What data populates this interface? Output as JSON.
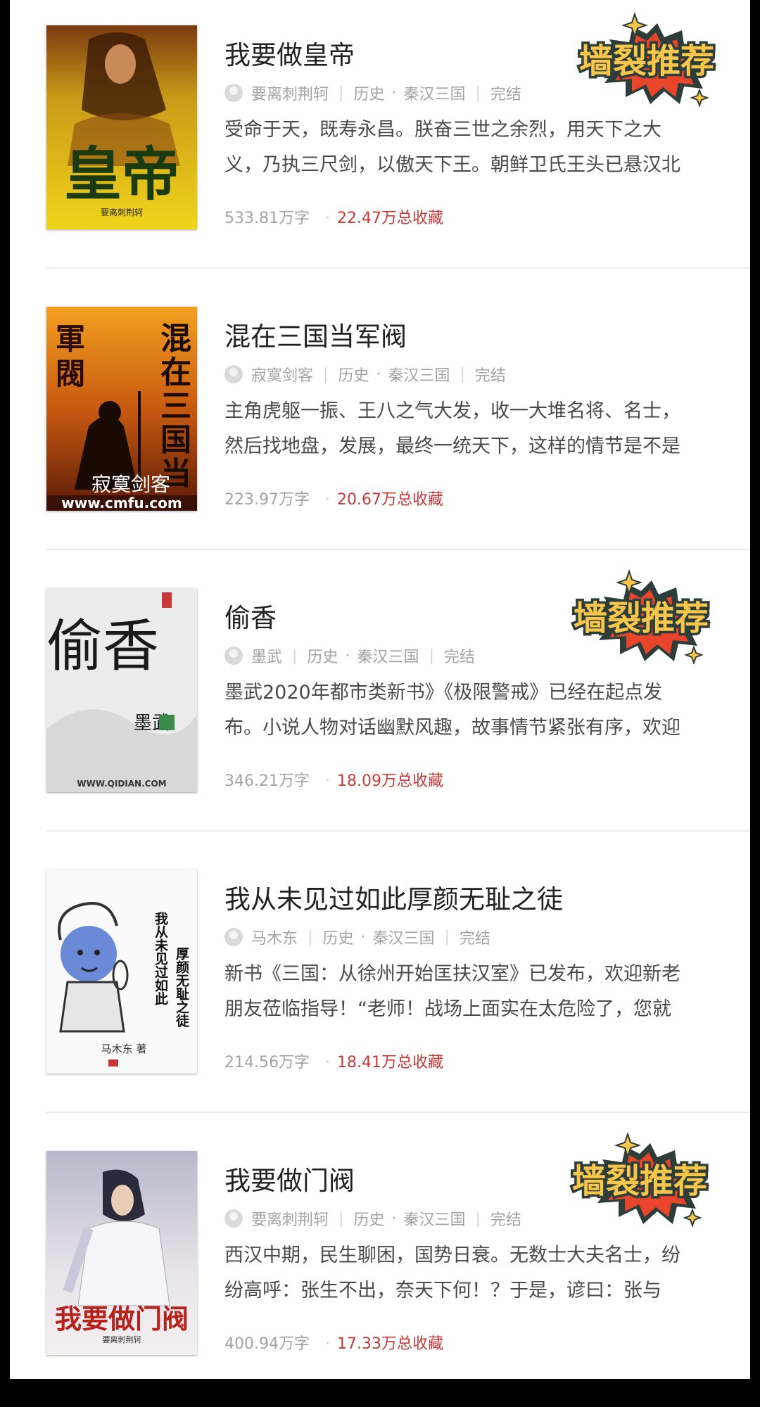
{
  "books": [
    {
      "title": "我要做皇帝",
      "author": "要离刺荆轲",
      "category": "历史",
      "subcategory": "秦汉三国",
      "status": "完结",
      "desc_line1": "受命于天，既寿永昌。朕奋三世之余烈，用天下之大",
      "desc_line2": "义，乃执三尺剑，以傲天下王。朝鲜卫氏王头已悬汉北",
      "words": "533.81万字",
      "favorites": "22.47万总收藏",
      "badge": "墙裂推荐",
      "cover_big": "皇帝",
      "cover_small": "要离刺荆轲"
    },
    {
      "title": "混在三国当军阀",
      "author": "寂寞剑客",
      "category": "历史",
      "subcategory": "秦汉三国",
      "status": "完结",
      "desc_line1": "主角虎躯一振、王八之气大发，收一大堆名将、名士，",
      "desc_line2": "然后找地盘，发展，最终一统天下，这样的情节是不是",
      "words": "223.97万字",
      "favorites": "20.67万总收藏",
      "badge": "",
      "cover_big": "混在三国当",
      "cover_small": "軍閥",
      "cover_url": "www.cmfu.com",
      "cover_author": "寂寞剑客"
    },
    {
      "title": "偷香",
      "author": "墨武",
      "category": "历史",
      "subcategory": "秦汉三国",
      "status": "完结",
      "desc_line1": "墨武2020年都市类新书》《极限警戒》已经在起点发",
      "desc_line2": "布。小说人物对话幽默风趣，故事情节紧张有序，欢迎",
      "words": "346.21万字",
      "favorites": "18.09万总收藏",
      "badge": "墙裂推荐",
      "cover_big": "偷香",
      "cover_small": "墨武",
      "cover_url": "WWW.QIDIAN.COM"
    },
    {
      "title": "我从未见过如此厚颜无耻之徒",
      "author": "马木东",
      "category": "历史",
      "subcategory": "秦汉三国",
      "status": "完结",
      "desc_line1": "新书《三国：从徐州开始匡扶汉室》已发布，欢迎新老",
      "desc_line2": "朋友莅临指导！“老师！战场上面实在太危险了，您就",
      "words": "214.56万字",
      "favorites": "18.41万总收藏",
      "badge": "",
      "cover_big": "我从未见过如此",
      "cover_small": "厚颜无耻之徒",
      "cover_author": "马木东 著"
    },
    {
      "title": "我要做门阀",
      "author": "要离刺荆轲",
      "category": "历史",
      "subcategory": "秦汉三国",
      "status": "完结",
      "desc_line1": "西汉中期，民生聊困，国势日衰。无数士大夫名士，纷",
      "desc_line2": "纷高呼：张生不出，奈天下何！？于是，谚曰：张与",
      "words": "400.94万字",
      "favorites": "17.33万总收藏",
      "badge": "墙裂推荐",
      "cover_big": "我要做门阀",
      "cover_small": "要离刺荆轲"
    }
  ]
}
